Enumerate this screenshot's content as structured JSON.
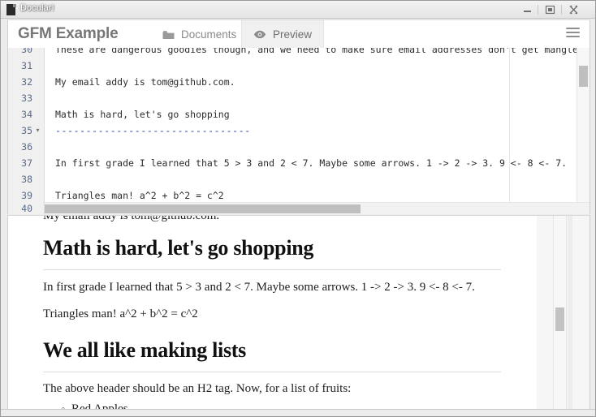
{
  "window": {
    "title": "Docular!",
    "icon": "document-icon",
    "controls": {
      "minimize": "minimize-icon",
      "maximize": "maximize-icon",
      "close": "close-icon"
    }
  },
  "header": {
    "brand": "GFM Example",
    "tabs": [
      {
        "label": "Documents",
        "icon": "folder-icon",
        "active": false
      },
      {
        "label": "Preview",
        "icon": "eye-icon",
        "active": true
      }
    ],
    "menu_icon": "hamburger-menu-icon"
  },
  "editor": {
    "first_line_number": 30,
    "lines": [
      {
        "num": "30",
        "text": "These are dangerous goodies though, and we need to make sure email addresses don't get mangled",
        "fold": false,
        "kind": "text"
      },
      {
        "num": "31",
        "text": "",
        "fold": false,
        "kind": "text"
      },
      {
        "num": "32",
        "text": "My email addy is tom@github.com.",
        "fold": false,
        "kind": "text"
      },
      {
        "num": "33",
        "text": "",
        "fold": false,
        "kind": "text"
      },
      {
        "num": "34",
        "text": "Math is hard, let's go shopping",
        "fold": false,
        "kind": "text"
      },
      {
        "num": "35",
        "text": "--------------------------------",
        "fold": true,
        "kind": "dashes"
      },
      {
        "num": "36",
        "text": "",
        "fold": false,
        "kind": "text"
      },
      {
        "num": "37",
        "text": "In first grade I learned that 5 > 3 and 2 < 7. Maybe some arrows. 1 -> 2 -> 3. 9 <- 8 <- 7.",
        "fold": false,
        "kind": "text"
      },
      {
        "num": "38",
        "text": "",
        "fold": false,
        "kind": "text"
      },
      {
        "num": "39",
        "text": "Triangles man! a^2 + b^2 = c^2",
        "fold": false,
        "kind": "text"
      },
      {
        "num": "40",
        "text": "",
        "fold": false,
        "kind": "text"
      }
    ],
    "fold_marker": "▾",
    "colors": {
      "gutter_bg": "#f0f0f0",
      "gutter_text": "#5b6b86",
      "code_text": "#2c2c2c",
      "dash_text": "#2b3ea8"
    }
  },
  "preview": {
    "cut_line": "My email addy is tom@github.com.",
    "blocks": [
      {
        "type": "h2",
        "text": "Math is hard, let's go shopping"
      },
      {
        "type": "hr"
      },
      {
        "type": "p",
        "text": "In first grade I learned that 5 > 3 and 2 < 7. Maybe some arrows. 1 -> 2 -> 3. 9 <- 8 <- 7."
      },
      {
        "type": "p",
        "text": "Triangles man! a^2 + b^2 = c^2"
      },
      {
        "type": "h2",
        "text": "We all like making lists"
      },
      {
        "type": "hr"
      },
      {
        "type": "p",
        "text": "The above header should be an H2 tag. Now, for a list of fruits:"
      },
      {
        "type": "li",
        "text": "Red Apples"
      }
    ]
  }
}
